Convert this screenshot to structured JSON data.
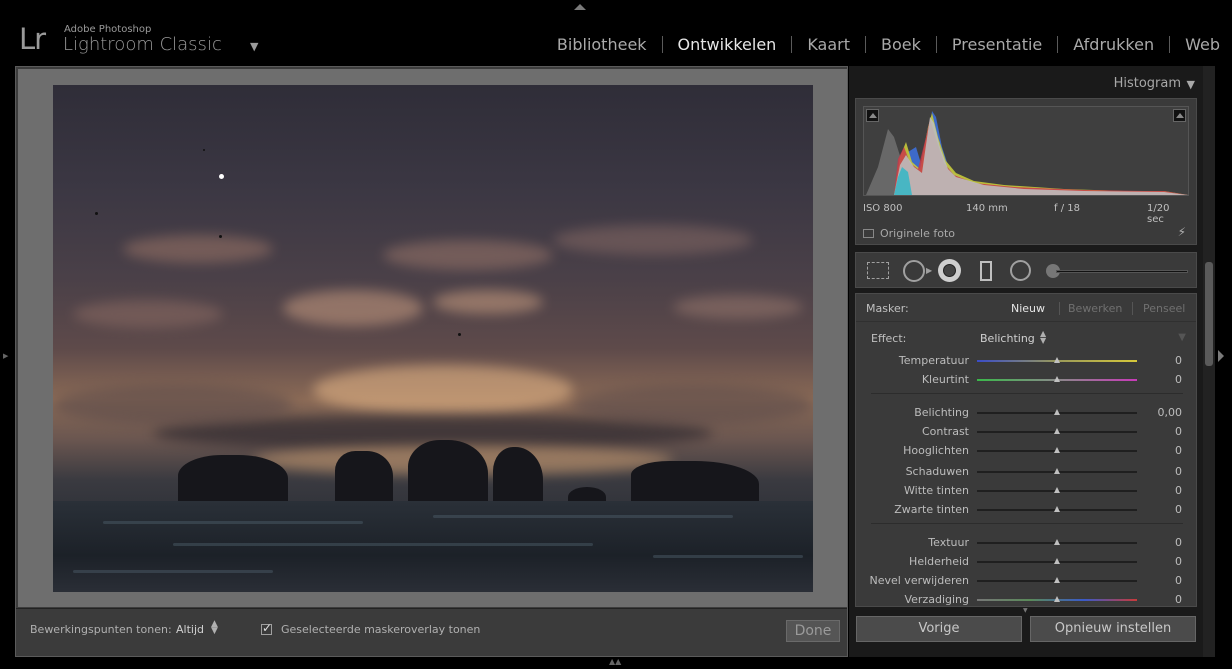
{
  "app": {
    "logo": "Lr",
    "maker": "Adobe Photoshop",
    "name": "Lightroom Classic",
    "dropdown": "▼"
  },
  "modules": [
    {
      "label": "Bibliotheek",
      "active": false
    },
    {
      "label": "Ontwikkelen",
      "active": true
    },
    {
      "label": "Kaart",
      "active": false
    },
    {
      "label": "Boek",
      "active": false
    },
    {
      "label": "Presentatie",
      "active": false
    },
    {
      "label": "Afdrukken",
      "active": false
    },
    {
      "label": "Web",
      "active": false
    }
  ],
  "toolbar": {
    "pins_label": "Bewerkingspunten tonen:",
    "pins_value": "Altijd",
    "overlay_checked": true,
    "overlay_label": "Geselecteerde maskeroverlay tonen",
    "done_label": "Done"
  },
  "histogram": {
    "title": "Histogram",
    "iso": "ISO 800",
    "focal": "140 mm",
    "aperture": "f / 18",
    "shutter": "1/20 sec",
    "original_label": "Originele foto"
  },
  "mask": {
    "label": "Masker:",
    "new": "Nieuw",
    "edit": "Bewerken",
    "brush": "Penseel",
    "effect_label": "Effect:",
    "effect_value": "Belichting"
  },
  "sliders": [
    {
      "label": "Temperatuur",
      "value": "0",
      "position": 0.5,
      "track": "temp"
    },
    {
      "label": "Kleurtint",
      "value": "0",
      "position": 0.5,
      "track": "tint"
    },
    {
      "label": "Belichting",
      "value": "0,00",
      "position": 0.5,
      "track": "gray"
    },
    {
      "label": "Contrast",
      "value": "0",
      "position": 0.5,
      "track": "gray"
    },
    {
      "label": "Hooglichten",
      "value": "0",
      "position": 0.5,
      "track": "gray"
    },
    {
      "label": "Schaduwen",
      "value": "0",
      "position": 0.5,
      "track": "gray"
    },
    {
      "label": "Witte tinten",
      "value": "0",
      "position": 0.5,
      "track": "gray"
    },
    {
      "label": "Zwarte tinten",
      "value": "0",
      "position": 0.5,
      "track": "gray"
    },
    {
      "label": "Textuur",
      "value": "0",
      "position": 0.5,
      "track": "gray"
    },
    {
      "label": "Helderheid",
      "value": "0",
      "position": 0.5,
      "track": "gray"
    },
    {
      "label": "Nevel verwijderen",
      "value": "0",
      "position": 0.5,
      "track": "gray"
    },
    {
      "label": "Verzadiging",
      "value": "0",
      "position": 0.5,
      "track": "sat"
    }
  ],
  "buttons": {
    "previous": "Vorige",
    "reset": "Opnieuw instellen"
  },
  "icons": {
    "crop": "crop-overlay-icon",
    "spot": "spot-removal-icon",
    "redeye": "red-eye-icon",
    "graduated": "graduated-filter-icon",
    "radial": "radial-filter-icon",
    "brush": "adjustment-brush-icon",
    "bolt": "lightning-bolt-icon"
  },
  "colors": {
    "active_module": "#e6e6e6",
    "inactive_module": "#a9a9a9",
    "panel_bg": "#3a3a3a"
  }
}
